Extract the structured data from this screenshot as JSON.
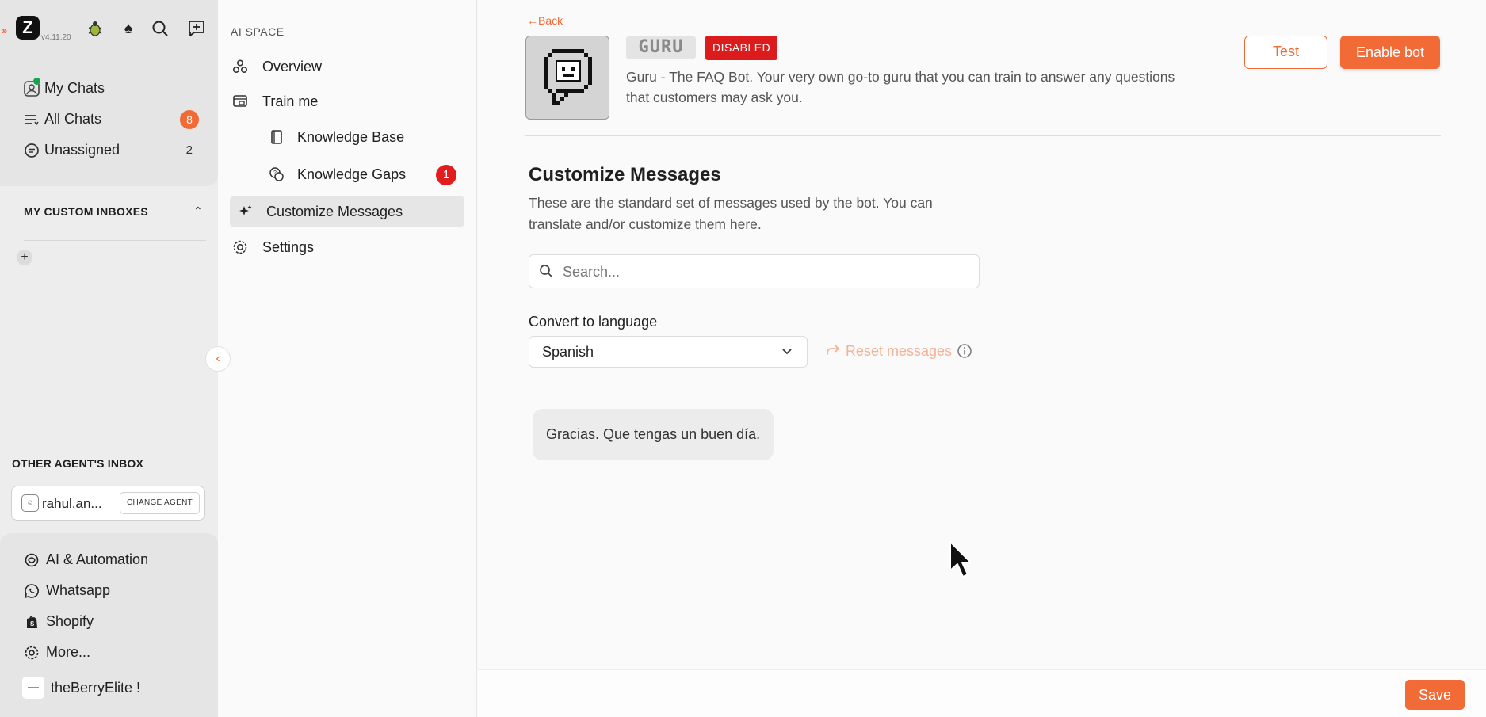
{
  "app": {
    "version": "v4.11.20",
    "accent": "#f26a35",
    "top_icons": [
      "bug-icon",
      "spade-icon",
      "search-icon",
      "new-chat-icon"
    ]
  },
  "sidebar": {
    "chats": [
      {
        "label": "My Chats",
        "icon": "chat-avatar-icon",
        "count": ""
      },
      {
        "label": "All Chats",
        "icon": "list-icon",
        "count": "8"
      },
      {
        "label": "Unassigned",
        "icon": "chat-bubble-icon",
        "count": "2"
      }
    ],
    "custom_inboxes_title": "MY CUSTOM INBOXES",
    "other_agents_title": "OTHER AGENT'S INBOX",
    "agent_name": "rahul.an...",
    "change_agent_label": "CHANGE AGENT",
    "bottom_nav": [
      {
        "label": "AI & Automation",
        "icon": "ai-icon"
      },
      {
        "label": "Whatsapp",
        "icon": "whatsapp-icon"
      },
      {
        "label": "Shopify",
        "icon": "shopify-icon"
      },
      {
        "label": "More...",
        "icon": "gear-icon"
      }
    ],
    "store_name": "theBerryElite !"
  },
  "ai_space": {
    "title": "AI SPACE",
    "items": [
      {
        "label": "Overview",
        "icon": "overview-icon"
      },
      {
        "label": "Train me",
        "icon": "train-icon"
      },
      {
        "label": "Knowledge Base",
        "icon": "book-icon"
      },
      {
        "label": "Knowledge Gaps",
        "icon": "gaps-icon",
        "badge": "1"
      },
      {
        "label": "Customize Messages",
        "icon": "sparkle-icon",
        "active": true
      },
      {
        "label": "Settings",
        "icon": "settings-icon"
      }
    ]
  },
  "bot": {
    "back_label": "Back",
    "name": "GURU",
    "status": "DISABLED",
    "status_color": "#dc1c1c",
    "description": "Guru - The FAQ Bot. Your very own go-to guru that you can train to answer any questions that customers may ask you.",
    "test_label": "Test",
    "enable_label": "Enable bot"
  },
  "customize": {
    "title": "Customize Messages",
    "description": "These are the standard set of messages used by the bot. You can translate and/or customize them here.",
    "search_placeholder": "Search...",
    "language_label": "Convert to language",
    "language_value": "Spanish",
    "reset_label": "Reset messages",
    "messages": [
      "Gracias. Que tengas un buen día."
    ]
  },
  "footer": {
    "save_label": "Save"
  }
}
